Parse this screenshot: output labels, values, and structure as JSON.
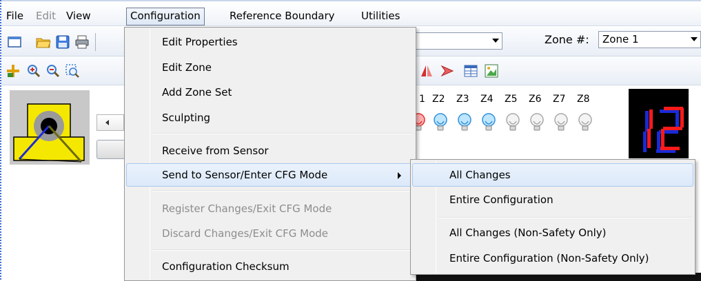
{
  "menubar": {
    "items": [
      {
        "label": "File",
        "state": "normal"
      },
      {
        "label": "Edit",
        "state": "disabled"
      },
      {
        "label": "View",
        "state": "normal"
      },
      {
        "label": "Configuration",
        "state": "open"
      },
      {
        "label": "Reference Boundary",
        "state": "normal"
      },
      {
        "label": "Utilities",
        "state": "normal"
      }
    ]
  },
  "toolbar1": {
    "icons": [
      "new-icon",
      "open-folder-icon",
      "save-icon",
      "print-icon"
    ],
    "zone_label": "Zone #:",
    "zone_value": "Zone 1"
  },
  "toolbar2": {
    "icons": [
      "origin-icon",
      "zoom-in-icon",
      "zoom-out-icon",
      "zoom-fit-icon",
      "mirror-icon",
      "rotate-icon",
      "table-icon",
      "image-icon"
    ]
  },
  "zones": {
    "headers": [
      "1",
      "Z2",
      "Z3",
      "Z4",
      "Z5",
      "Z6",
      "Z7",
      "Z8"
    ],
    "bulb_states": [
      "red",
      "blue",
      "blue",
      "blue",
      "gray",
      "gray",
      "gray",
      "gray"
    ]
  },
  "display": {
    "value": "12",
    "color": "#ff1a1a",
    "shadow_color": "#1a2bd6"
  },
  "configuration_menu": {
    "items": [
      {
        "label": "Edit Properties",
        "state": "normal"
      },
      {
        "label": "Edit Zone",
        "state": "normal"
      },
      {
        "label": "Add Zone Set",
        "state": "normal"
      },
      {
        "label": "Sculpting",
        "state": "normal"
      },
      {
        "label": "Receive from Sensor",
        "state": "normal"
      },
      {
        "label": "Send to Sensor/Enter CFG Mode",
        "state": "highlight",
        "has_submenu": true
      },
      {
        "label": "Register Changes/Exit CFG Mode",
        "state": "disabled"
      },
      {
        "label": "Discard Changes/Exit CFG Mode",
        "state": "disabled"
      },
      {
        "label": "Configuration Checksum",
        "state": "normal"
      }
    ]
  },
  "send_submenu": {
    "items": [
      {
        "label": "All Changes",
        "state": "highlight"
      },
      {
        "label": "Entire Configuration",
        "state": "normal"
      },
      {
        "label": "All Changes (Non-Safety Only)",
        "state": "normal"
      },
      {
        "label": "Entire Configuration (Non-Safety Only)",
        "state": "normal"
      }
    ]
  },
  "colors": {
    "menu_highlight": "#dce9f9",
    "menu_highlight_border": "#a8c8ef",
    "disabled_text": "#8d8d8d",
    "yellow_sensor": "#f5e800"
  }
}
